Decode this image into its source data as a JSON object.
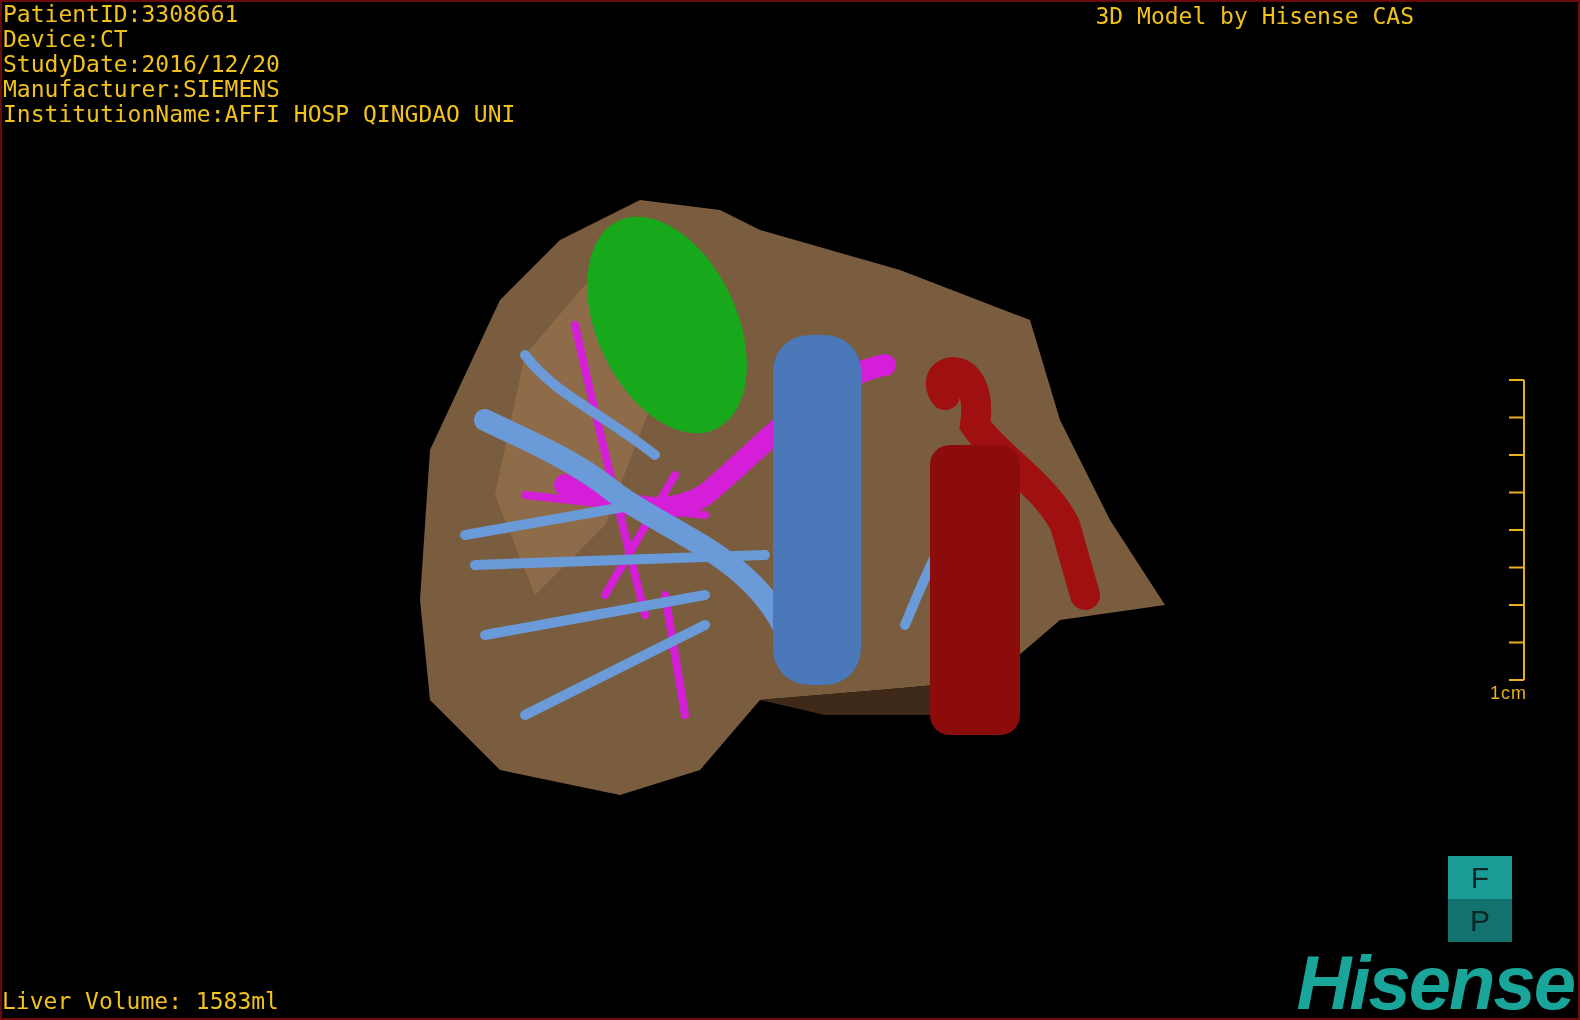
{
  "info": [
    "PatientID:3308661",
    "Device:CT",
    "StudyDate:2016/12/20",
    "Manufacturer:SIEMENS",
    "InstitutionName:AFFI HOSP QINGDAO UNI"
  ],
  "credit": "3D Model by Hisense CAS",
  "scale": {
    "label": "1cm"
  },
  "orientation": {
    "top": "F",
    "bottom": "P"
  },
  "volume": "Liver Volume: 1583ml",
  "logo": "Hisense"
}
